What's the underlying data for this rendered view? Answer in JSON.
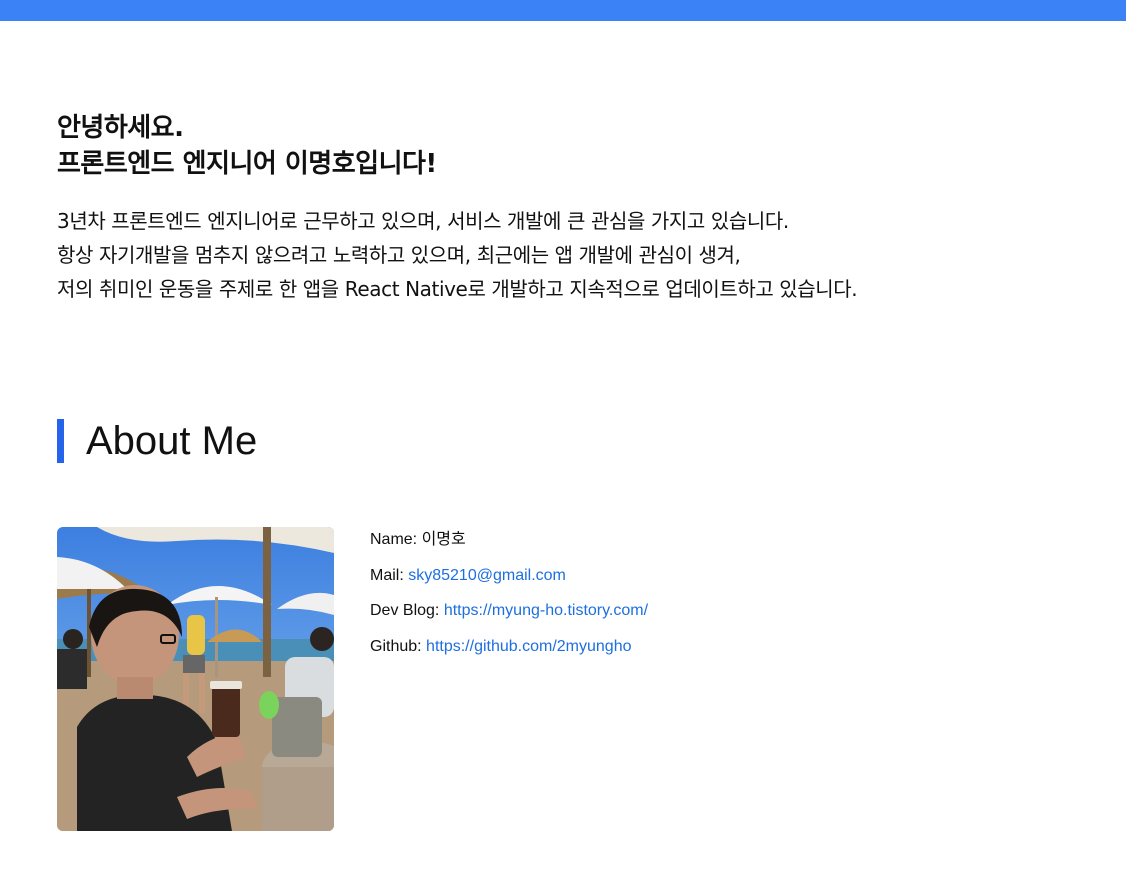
{
  "intro": {
    "greeting_line1": "안녕하세요.",
    "greeting_line2": "프론트엔드 엔지니어 이명호입니다!",
    "bio_lines": [
      "3년차 프론트엔드 엔지니어로 근무하고 있으며, 서비스 개발에 큰 관심을 가지고 있습니다.",
      "항상 자기개발을 멈추지 않으려고 노력하고 있으며, 최근에는 앱 개발에 관심이 생겨,",
      "저의 취미인 운동을 주제로 한 앱을 React Native로 개발하고 지속적으로 업데이트하고 있습니다."
    ]
  },
  "about": {
    "title": "About Me",
    "fields": [
      {
        "label": "Name:",
        "value": "이명호",
        "link": false
      },
      {
        "label": "Mail:",
        "value": "sky85210@gmail.com",
        "link": true
      },
      {
        "label": "Dev Blog:",
        "value": "https://myung-ho.tistory.com/",
        "link": true
      },
      {
        "label": "Github:",
        "value": "https://github.com/2myungho",
        "link": true
      }
    ]
  },
  "colors": {
    "top_bar": "#3b82f6",
    "accent": "#2563eb",
    "link": "#1d6fe0"
  }
}
